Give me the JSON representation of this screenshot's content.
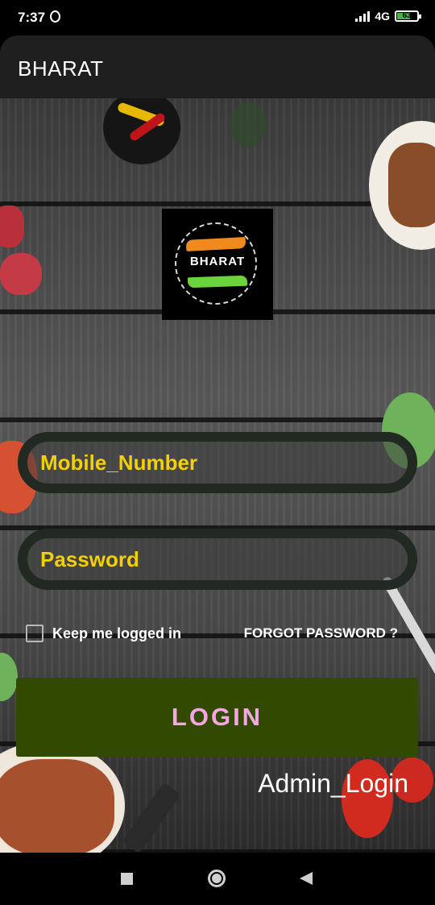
{
  "status": {
    "time": "7:37",
    "network": "4G",
    "battery": "63"
  },
  "appbar": {
    "title": "BHARAT"
  },
  "logo": {
    "text": "BHARAT"
  },
  "form": {
    "mobile_placeholder": "Mobile_Number",
    "password_placeholder": "Password",
    "keep_logged_in": "Keep me logged in",
    "forgot_password": "FORGOT PASSWORD ?",
    "login_button": "LOGIN",
    "admin_login": "Admin_Login"
  },
  "colors": {
    "field_text": "#f5d000",
    "login_bg": "#314a00",
    "login_text": "#f6a6e4",
    "appbar_bg": "#1f1f1f"
  }
}
